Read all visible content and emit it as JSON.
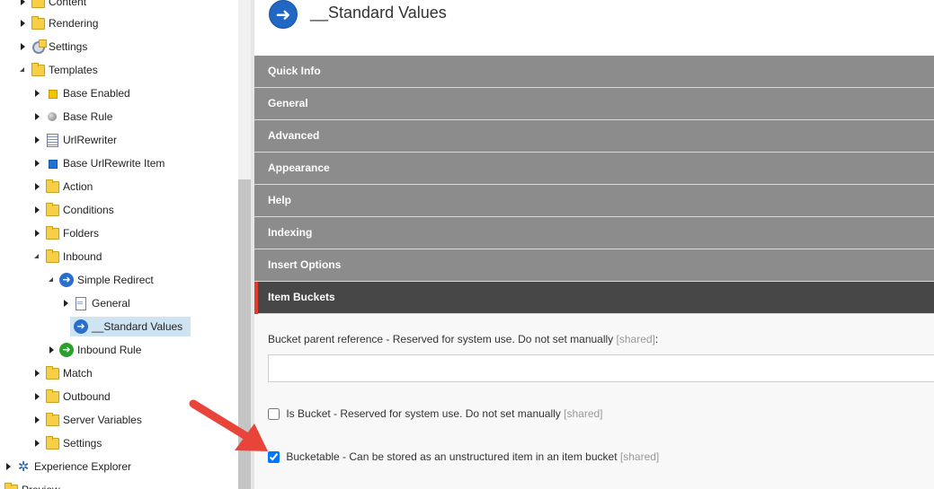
{
  "tree": {
    "nodes": [
      {
        "label": "Content",
        "toggle": "collapsed",
        "icon": "folder-icon"
      },
      {
        "label": "Rendering",
        "toggle": "collapsed",
        "icon": "folder-icon"
      },
      {
        "label": "Settings",
        "toggle": "collapsed",
        "icon": "settings-folder-icon"
      },
      {
        "label": "Templates",
        "toggle": "expanded",
        "icon": "folder-icon"
      },
      {
        "label": "Base Enabled",
        "toggle": "collapsed",
        "icon": "yellow-square-icon"
      },
      {
        "label": "Base Rule",
        "toggle": "collapsed",
        "icon": "grey-ball-icon"
      },
      {
        "label": "UrlRewriter",
        "toggle": "collapsed",
        "icon": "list-document-icon"
      },
      {
        "label": "Base UrlRewrite Item",
        "toggle": "collapsed",
        "icon": "blue-square-icon"
      },
      {
        "label": "Action",
        "toggle": "collapsed",
        "icon": "folder-icon"
      },
      {
        "label": "Conditions",
        "toggle": "collapsed",
        "icon": "folder-icon"
      },
      {
        "label": "Folders",
        "toggle": "collapsed",
        "icon": "folder-icon"
      },
      {
        "label": "Inbound",
        "toggle": "expanded",
        "icon": "folder-icon"
      },
      {
        "label": "Simple Redirect",
        "toggle": "expanded",
        "icon": "blue-arrow-icon"
      },
      {
        "label": "General",
        "toggle": "collapsed",
        "icon": "document-icon"
      },
      {
        "label": "__Standard Values",
        "toggle": "none",
        "icon": "blue-arrow-icon",
        "selected": true
      },
      {
        "label": "Inbound Rule",
        "toggle": "collapsed",
        "icon": "green-arrow-icon"
      },
      {
        "label": "Match",
        "toggle": "collapsed",
        "icon": "folder-icon"
      },
      {
        "label": "Outbound",
        "toggle": "collapsed",
        "icon": "folder-icon"
      },
      {
        "label": "Server Variables",
        "toggle": "collapsed",
        "icon": "folder-icon"
      },
      {
        "label": "Settings",
        "toggle": "collapsed",
        "icon": "folder-icon"
      },
      {
        "label": "Experience Explorer",
        "toggle": "collapsed",
        "icon": "explorer-icon"
      },
      {
        "label": "Preview",
        "toggle": "none",
        "icon": "folder-icon"
      }
    ]
  },
  "editor": {
    "title": "__Standard Values",
    "icon": "blue-arrow-icon",
    "sections": [
      {
        "label": "Quick Info"
      },
      {
        "label": "General"
      },
      {
        "label": "Advanced"
      },
      {
        "label": "Appearance"
      },
      {
        "label": "Help"
      },
      {
        "label": "Indexing"
      },
      {
        "label": "Insert Options"
      },
      {
        "label": "Item Buckets",
        "active": true
      }
    ],
    "fields": {
      "bucket_parent": {
        "label": "Bucket parent reference - Reserved for system use. Do not set manually",
        "shared": "[shared]",
        "suffix": ":",
        "value": ""
      },
      "is_bucket": {
        "label": "Is Bucket - Reserved for system use. Do not set manually",
        "shared": "[shared]",
        "checked": false
      },
      "bucketable": {
        "label": "Bucketable - Can be stored as an unstructured item in an item bucket",
        "shared": "[shared]",
        "checked": true
      }
    }
  },
  "colors": {
    "section_bg": "#8c8c8c",
    "section_active_bg": "#474747",
    "section_active_marker": "#e23b2e",
    "annotation_arrow": "#e8443a",
    "selected_bg": "#cfe4f3"
  }
}
